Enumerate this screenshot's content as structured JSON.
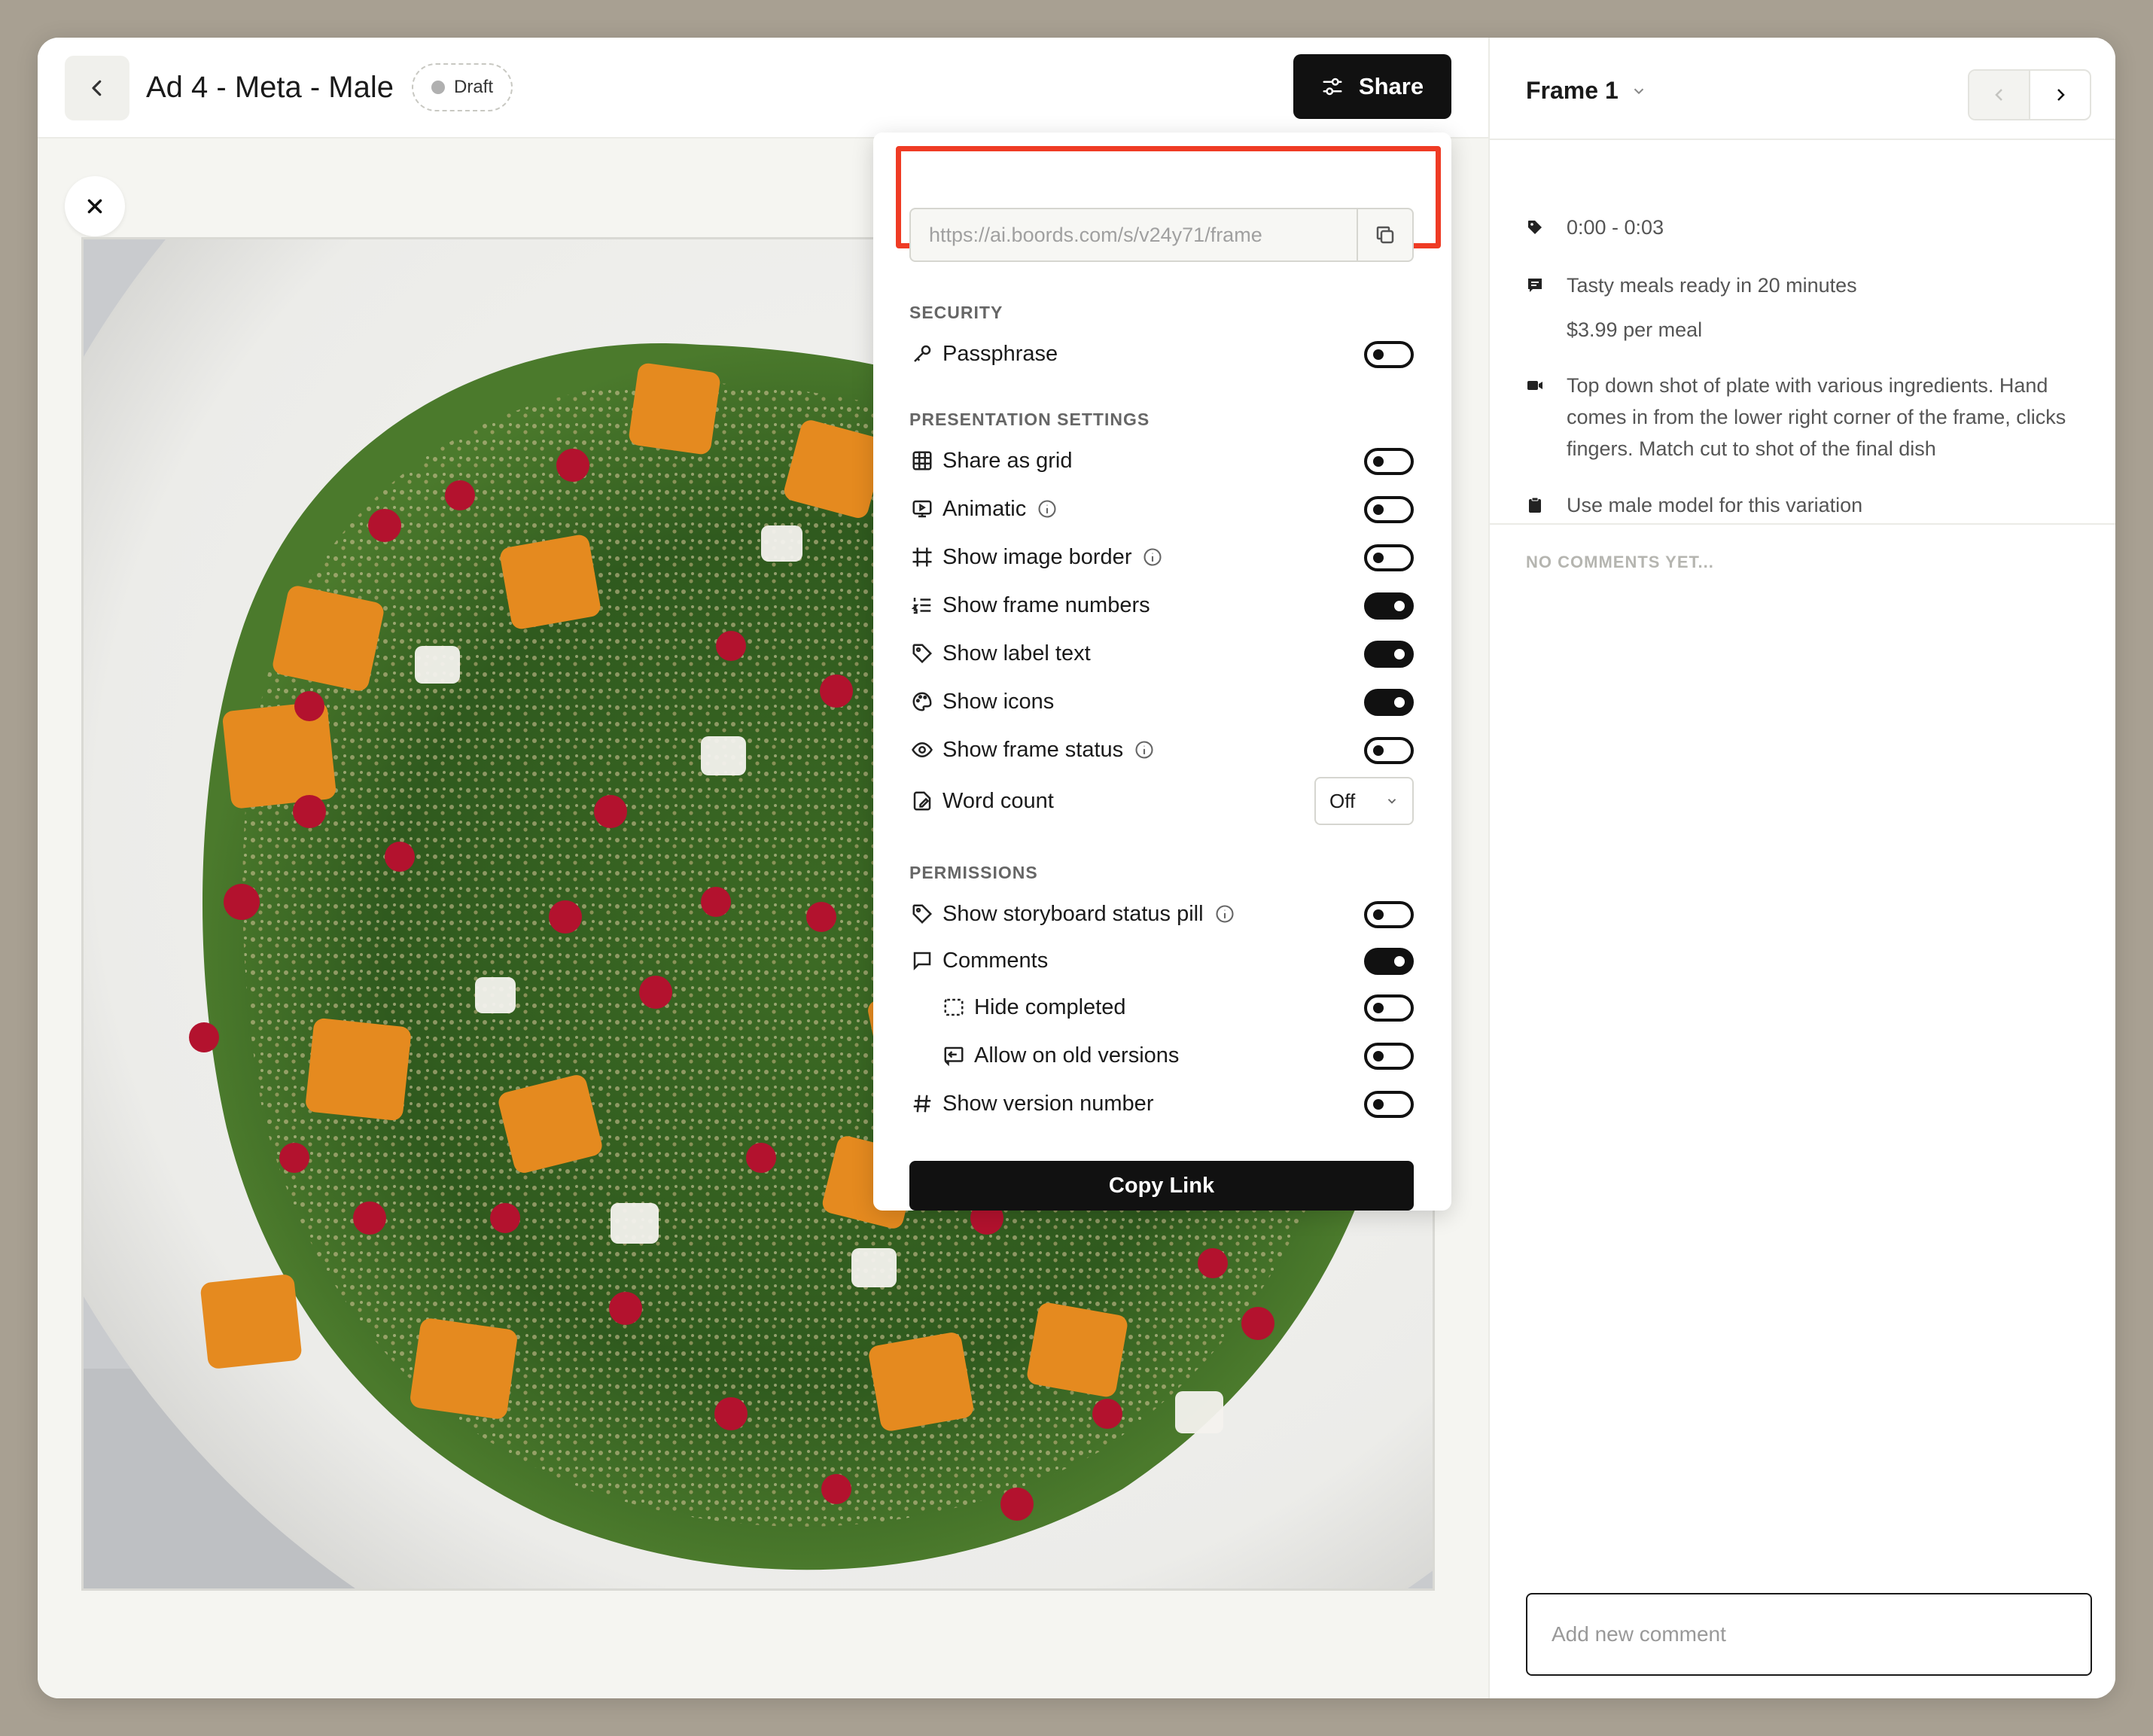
{
  "header": {
    "title": "Ad 4 - Meta - Male",
    "status_badge": "Draft",
    "share_label": "Share"
  },
  "share_panel": {
    "url": "https://ai.boords.com/s/v24y71/frame",
    "sections": {
      "security": "SECURITY",
      "presentation": "PRESENTATION SETTINGS",
      "permissions": "PERMISSIONS"
    },
    "options": {
      "passphrase": {
        "label": "Passphrase",
        "on": false
      },
      "share_as_grid": {
        "label": "Share as grid",
        "on": false
      },
      "animatic": {
        "label": "Animatic",
        "on": false
      },
      "show_image_border": {
        "label": "Show image border",
        "on": false
      },
      "show_frame_numbers": {
        "label": "Show frame numbers",
        "on": true
      },
      "show_label_text": {
        "label": "Show label text",
        "on": true
      },
      "show_icons": {
        "label": "Show icons",
        "on": true
      },
      "show_frame_status": {
        "label": "Show frame status",
        "on": false
      },
      "word_count": {
        "label": "Word count",
        "value": "Off"
      },
      "show_storyboard_status_pill": {
        "label": "Show storyboard status pill",
        "on": false
      },
      "comments": {
        "label": "Comments",
        "on": true
      },
      "hide_completed": {
        "label": "Hide completed",
        "on": false
      },
      "allow_on_old_versions": {
        "label": "Allow on old versions",
        "on": false
      },
      "show_version_number": {
        "label": "Show version number",
        "on": false
      }
    },
    "copy_link_label": "Copy Link"
  },
  "frame_panel": {
    "frame_name": "Frame 1",
    "time_range": "0:00 - 0:03",
    "label_text_line1": "Tasty meals ready in 20 minutes",
    "label_text_line2": "$3.99 per meal",
    "action_text": "Top down shot of plate with various ingredients. Hand comes in from the lower right corner of the frame, clicks fingers. Match cut to shot of the final dish",
    "note_text": "Use male model for this variation",
    "no_comments": "NO COMMENTS YET...",
    "comment_placeholder": "Add new comment"
  },
  "colors": {
    "highlight": "#ef3b24",
    "primary": "#111111",
    "background": "#a8a092"
  }
}
